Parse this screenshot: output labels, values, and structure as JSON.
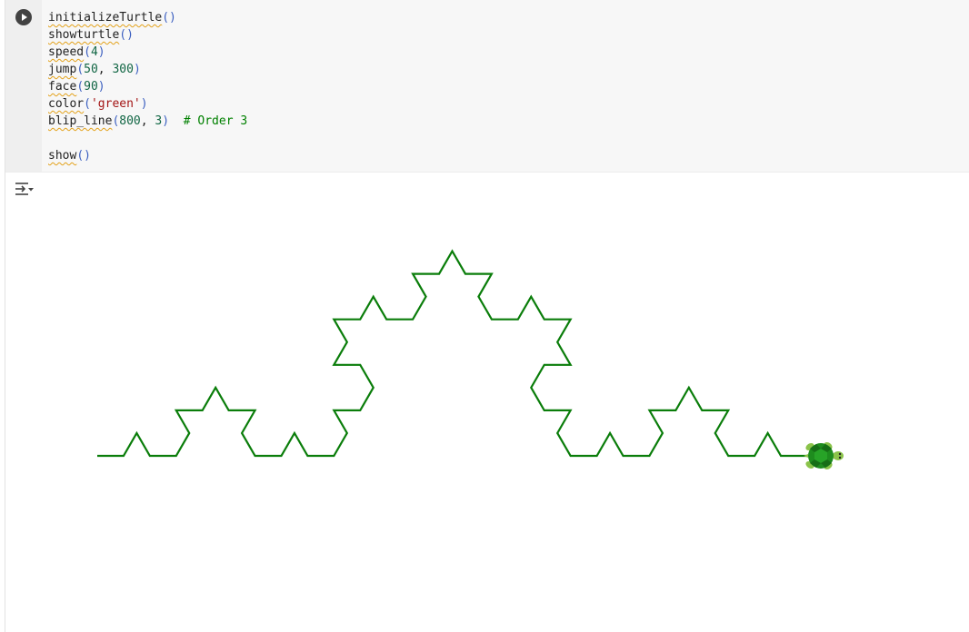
{
  "cell": {
    "code_lines": [
      [
        {
          "t": "initializeTurtle",
          "c": "fn"
        },
        {
          "t": "()",
          "c": "paren"
        }
      ],
      [
        {
          "t": "showturtle",
          "c": "fn"
        },
        {
          "t": "()",
          "c": "paren"
        }
      ],
      [
        {
          "t": "speed",
          "c": "fn"
        },
        {
          "t": "(",
          "c": "paren"
        },
        {
          "t": "4",
          "c": "num"
        },
        {
          "t": ")",
          "c": "paren"
        }
      ],
      [
        {
          "t": "jump",
          "c": "fn"
        },
        {
          "t": "(",
          "c": "paren"
        },
        {
          "t": "50",
          "c": "num"
        },
        {
          "t": ", ",
          "c": "plain"
        },
        {
          "t": "300",
          "c": "num"
        },
        {
          "t": ")",
          "c": "paren"
        }
      ],
      [
        {
          "t": "face",
          "c": "fn"
        },
        {
          "t": "(",
          "c": "paren"
        },
        {
          "t": "90",
          "c": "num"
        },
        {
          "t": ")",
          "c": "paren"
        }
      ],
      [
        {
          "t": "color",
          "c": "fn"
        },
        {
          "t": "(",
          "c": "paren"
        },
        {
          "t": "'green'",
          "c": "str"
        },
        {
          "t": ")",
          "c": "paren"
        }
      ],
      [
        {
          "t": "blip_line",
          "c": "fn"
        },
        {
          "t": "(",
          "c": "paren"
        },
        {
          "t": "800",
          "c": "num"
        },
        {
          "t": ", ",
          "c": "plain"
        },
        {
          "t": "3",
          "c": "num"
        },
        {
          "t": ")",
          "c": "paren"
        },
        {
          "t": "  ",
          "c": "plain"
        },
        {
          "t": "# Order 3",
          "c": "cmt"
        }
      ],
      [],
      [
        {
          "t": "show",
          "c": "fn"
        },
        {
          "t": "()",
          "c": "paren"
        }
      ]
    ]
  },
  "turtle_output": {
    "line_color": "#0a7d0a",
    "turtle_icon": "turtle-icon",
    "curve": "koch",
    "order": 3,
    "length": 800
  },
  "icons": {
    "run": "play-icon",
    "output_toggle": "output-collapse-icon"
  },
  "colors": {
    "cell_background": "#f7f7f7",
    "run_button": "#424242",
    "turtle_shell": "#1e8c1e",
    "turtle_body": "#8bc34a"
  }
}
